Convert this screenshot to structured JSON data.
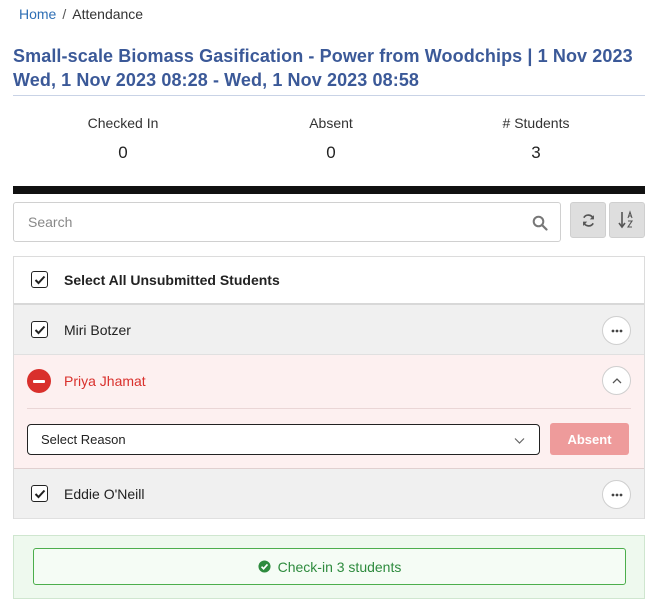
{
  "breadcrumb": {
    "home": "Home",
    "separator": "/",
    "current": "Attendance"
  },
  "page": {
    "title": "Small-scale Biomass Gasification - Power from Woodchips | 1 Nov 2023 Wed, 1 Nov 2023 08:28 - Wed, 1 Nov 2023 08:58"
  },
  "stats": {
    "checked_in": {
      "label": "Checked In",
      "value": "0"
    },
    "absent": {
      "label": "Absent",
      "value": "0"
    },
    "students": {
      "label": "# Students",
      "value": "3"
    }
  },
  "search": {
    "placeholder": "Search",
    "value": ""
  },
  "tools": {
    "refresh_icon": "refresh-icon",
    "sort_icon": "sort-alpha-down-icon"
  },
  "list": {
    "select_all_label": "Select All Unsubmitted Students",
    "students": [
      {
        "name": "Miri Botzer",
        "checked": true,
        "status": "unsubmitted",
        "action_icon": "ellipsis-icon"
      },
      {
        "name": "Priya Jhamat",
        "checked": false,
        "status": "absent",
        "action_icon": "chevron-up-icon",
        "reason_placeholder": "Select Reason",
        "absent_label": "Absent"
      },
      {
        "name": "Eddie O'Neill",
        "checked": true,
        "status": "unsubmitted",
        "action_icon": "ellipsis-icon"
      }
    ]
  },
  "footer": {
    "checkin_label": "Check-in 3 students"
  },
  "colors": {
    "title": "#3b5998",
    "link": "#2f6fb5",
    "absent_red": "#d9302c",
    "absent_button": "#ee9b9b",
    "success_green": "#2e8b3e",
    "footer_bg": "#eef9ee"
  }
}
